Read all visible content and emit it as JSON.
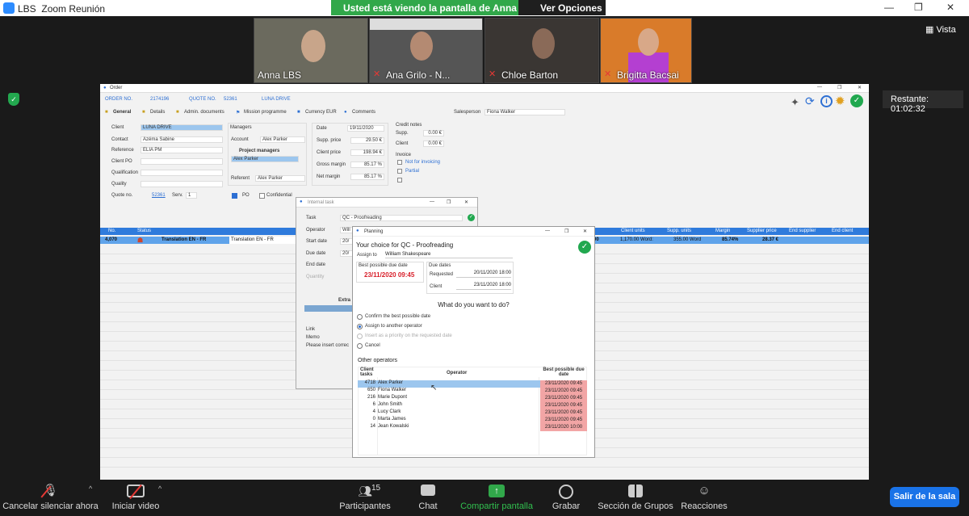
{
  "window": {
    "app": "LBS",
    "title": "Zoom Reunión"
  },
  "share_banner": {
    "message": "Usted está viendo la pantalla de Anna LBS",
    "options": "Ver Opciones"
  },
  "participants": [
    {
      "name": "Anna LBS",
      "muted": false
    },
    {
      "name": "Ana Grilo - N...",
      "muted": true
    },
    {
      "name": "Chloe Barton",
      "muted": true
    },
    {
      "name": "Brigitta Bacsai",
      "muted": true
    }
  ],
  "view_label": "Vista",
  "remaining": "Restante: 01:02:32",
  "order": {
    "window_title": "Order",
    "order_no_label": "ORDER NO.",
    "order_no": "2174196",
    "quote_no_label": "QUOTE NO.",
    "quote_no": "52361",
    "client_name": "LUNA DRIVE",
    "tabs": [
      "General",
      "Details",
      "Admin. documents",
      "Mission programme",
      "Currency EUR",
      "Comments"
    ],
    "salesperson_label": "Salesperson",
    "salesperson": "Fiona Walker",
    "client_label": "Client",
    "client": "LUNA DRIVE",
    "contact_label": "Contact",
    "contact": "Azéma Sabine",
    "reference_label": "Reference",
    "reference": "ELIA PM",
    "client_po_label": "Client PO",
    "qualification_label": "Qualification",
    "quality_label": "Quality",
    "quote_no2_label": "Quote no.",
    "quote_no2": "52361",
    "serv_label": "Serv.",
    "serv": "1",
    "managers_label": "Managers",
    "account_label": "Account",
    "account": "Alex Parker",
    "project_managers_label": "Project managers",
    "project_manager": "Alex Parker",
    "referent_label": "Referent",
    "referent": "Alex Parker",
    "po_label": "PO",
    "confidential_label": "Confidential",
    "date_label": "Date",
    "date": "19/11/2020",
    "supp_price_label": "Supp. price",
    "supp_price": "29.50 €",
    "client_price_label": "Client price",
    "client_price": "198.94 €",
    "gross_margin_label": "Gross margin",
    "gross_margin": "85.17 %",
    "net_margin_label": "Net margin",
    "net_margin": "85.17 %",
    "credit_notes_label": "Credit notes",
    "supp_label": "Supp.",
    "supp_cn": "0.00 €",
    "client_cn_label": "Client",
    "client_cn": "0.00 €",
    "invoice_label": "Invoice",
    "not_for_invoicing": "Not for invoicing",
    "partial": "Partial",
    "table_headers": [
      "No.",
      "Status",
      "",
      "",
      "Client units",
      "Supp. units",
      "Margin",
      "Supplier price",
      "End supplier",
      "End client"
    ],
    "row": {
      "no": "4,070",
      "task": "Translation EN - FR",
      "task2": "Translation EN - FR",
      "client_units": "1,170.00 Word:",
      "supp_units": "355.00 Word",
      "margin": "85.74%",
      "supplier_price": "28.37 €",
      "time": ":00"
    }
  },
  "internal_task": {
    "title": "Internal task",
    "task_label": "Task",
    "task": "QC - Proofreading",
    "operator_label": "Operator",
    "operator": "Will",
    "start_label": "Start date",
    "start": "20/",
    "due_label": "Due date",
    "due": "20/",
    "end_label": "End date",
    "quantity_label": "Quantity",
    "extra_label": "Extra",
    "link_label": "Link",
    "memo_label": "Memo",
    "note": "Please insert correc"
  },
  "planning": {
    "title": "Planning",
    "choice": "Your choice for QC - Proofreading",
    "assign_to_label": "Assign to",
    "assign_to": "William Shakespeare",
    "best_label": "Best possible due date",
    "best_date": "23/11/2020 09:45",
    "due_dates_label": "Due dates",
    "requested_label": "Requested",
    "requested": "20/11/2020 18:00",
    "client_label": "Client",
    "client_date": "23/11/2020 18:00",
    "question": "What do you want to do?",
    "options": [
      "Confirm the best possible date",
      "Assign to another operator",
      "Insert as a priority on the requested date",
      "Cancel"
    ],
    "other_ops": "Other operators",
    "col_client_tasks": "Client tasks",
    "col_operator": "Operator",
    "col_best": "Best possible due date",
    "operators": [
      {
        "count": "4718",
        "name": "Alex Parker",
        "date": "23/11/2020 09:45"
      },
      {
        "count": "650",
        "name": "Fiona Walker",
        "date": "23/11/2020 09:45"
      },
      {
        "count": "216",
        "name": "Marie Dupont",
        "date": "23/11/2020 09:45"
      },
      {
        "count": "6",
        "name": "John Smith",
        "date": "23/11/2020 09:45"
      },
      {
        "count": "4",
        "name": "Lucy Clark",
        "date": "23/11/2020 09:45"
      },
      {
        "count": "0",
        "name": "Marta James",
        "date": "23/11/2020 09:45"
      },
      {
        "count": "14",
        "name": "Jean Kowalski",
        "date": "23/11/2020 10:00"
      }
    ]
  },
  "toolbar": {
    "mute": "Cancelar silenciar ahora",
    "video": "Iniciar video",
    "participants": "Participantes",
    "participants_count": "15",
    "chat": "Chat",
    "share": "Compartir pantalla",
    "record": "Grabar",
    "breakout": "Sección de Grupos",
    "reactions": "Reacciones",
    "leave": "Salir de la sala"
  },
  "colors": {
    "accent": "#2d8cff",
    "share": "#31a84a",
    "leave": "#1a73e8",
    "date_red": "#f2a5a5"
  }
}
